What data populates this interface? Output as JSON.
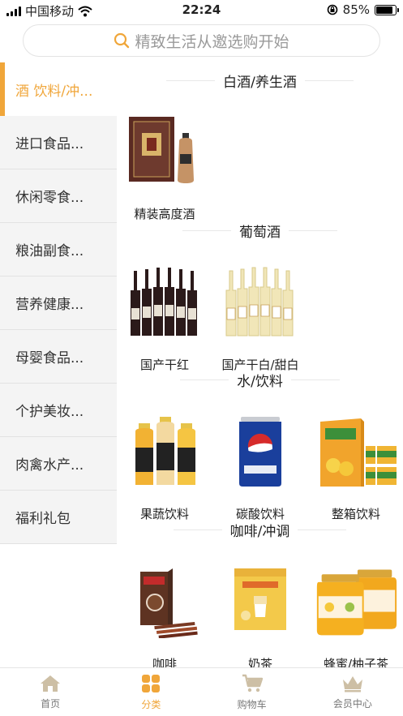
{
  "status_bar": {
    "carrier": "中国移动",
    "time": "22:24",
    "battery": "85%",
    "battery_level": 0.85
  },
  "search": {
    "placeholder": "精致生活从邀选购开始",
    "icon": "search-icon"
  },
  "sidebar": {
    "items": [
      {
        "label": "酒 饮料/冲..."
      },
      {
        "label": "进口食品..."
      },
      {
        "label": "休闲零食..."
      },
      {
        "label": "粮油副食..."
      },
      {
        "label": "营养健康..."
      },
      {
        "label": "母婴食品..."
      },
      {
        "label": "个护美妆..."
      },
      {
        "label": "肉禽水产..."
      },
      {
        "label": "福利礼包"
      }
    ],
    "active_index": 0
  },
  "sections": [
    {
      "title": "白酒/养生酒",
      "products": [
        {
          "name": "精装高度酒"
        }
      ]
    },
    {
      "title": "葡萄酒",
      "products": [
        {
          "name": "国产干红"
        },
        {
          "name": "国产干白/甜白"
        }
      ]
    },
    {
      "title": "水/饮料",
      "products": [
        {
          "name": "果蔬饮料"
        },
        {
          "name": "碳酸饮料"
        },
        {
          "name": "整箱饮料"
        }
      ]
    },
    {
      "title": "咖啡/冲调",
      "products": [
        {
          "name": "咖啡"
        },
        {
          "name": "奶茶"
        },
        {
          "name": "蜂蜜/柚子茶"
        }
      ]
    }
  ],
  "tabs": [
    {
      "label": "首页",
      "icon": "home-icon"
    },
    {
      "label": "分类",
      "icon": "category-icon"
    },
    {
      "label": "购物车",
      "icon": "cart-icon"
    },
    {
      "label": "会员中心",
      "icon": "crown-icon"
    }
  ],
  "colors": {
    "accent": "#f0a63a",
    "sidebar_bg": "#f4f4f4",
    "text": "#222222"
  }
}
